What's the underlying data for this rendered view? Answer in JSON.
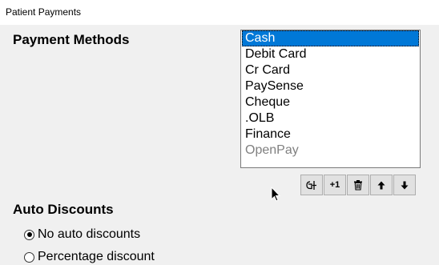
{
  "window": {
    "title": "Patient Payments"
  },
  "payment_methods": {
    "heading": "Payment Methods",
    "items": [
      {
        "label": "Cash",
        "selected": true,
        "enabled": true
      },
      {
        "label": "Debit Card",
        "selected": false,
        "enabled": true
      },
      {
        "label": "Cr Card",
        "selected": false,
        "enabled": true
      },
      {
        "label": "PaySense",
        "selected": false,
        "enabled": true
      },
      {
        "label": "Cheque",
        "selected": false,
        "enabled": true
      },
      {
        "label": ".OLB",
        "selected": false,
        "enabled": true
      },
      {
        "label": "Finance",
        "selected": false,
        "enabled": true
      },
      {
        "label": "OpenPay",
        "selected": false,
        "enabled": false
      }
    ],
    "toolbar": {
      "edit_icon": "edit-icon",
      "add_label": "+1",
      "delete_icon": "trash-icon",
      "move_up_icon": "arrow-up-icon",
      "move_down_icon": "arrow-down-icon"
    }
  },
  "auto_discounts": {
    "heading": "Auto Discounts",
    "options": [
      {
        "label": "No auto discounts",
        "checked": true
      },
      {
        "label": "Percentage discount",
        "checked": false
      }
    ]
  },
  "colors": {
    "selection": "#0078d7",
    "disabled_text": "#808080",
    "background": "#f0f0f0"
  }
}
